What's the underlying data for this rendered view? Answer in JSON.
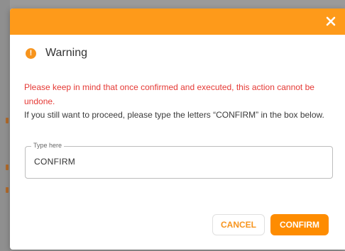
{
  "dialog": {
    "title": "Warning",
    "icon": "warning-icon",
    "close_icon": "close-icon",
    "danger_message": "Please keep in mind that once confirmed and executed, this action cannot be undone.",
    "info_message": "If you still want to proceed, please type the letters “CONFIRM” in the box below.",
    "field": {
      "label": "Type here",
      "value": "CONFIRM"
    },
    "buttons": {
      "cancel_label": "CANCEL",
      "confirm_label": "CONFIRM"
    }
  },
  "colors": {
    "header": "#fe9a1a",
    "accent": "#f7941d",
    "danger_text": "#e53935",
    "confirm_button": "#fe8c00"
  }
}
